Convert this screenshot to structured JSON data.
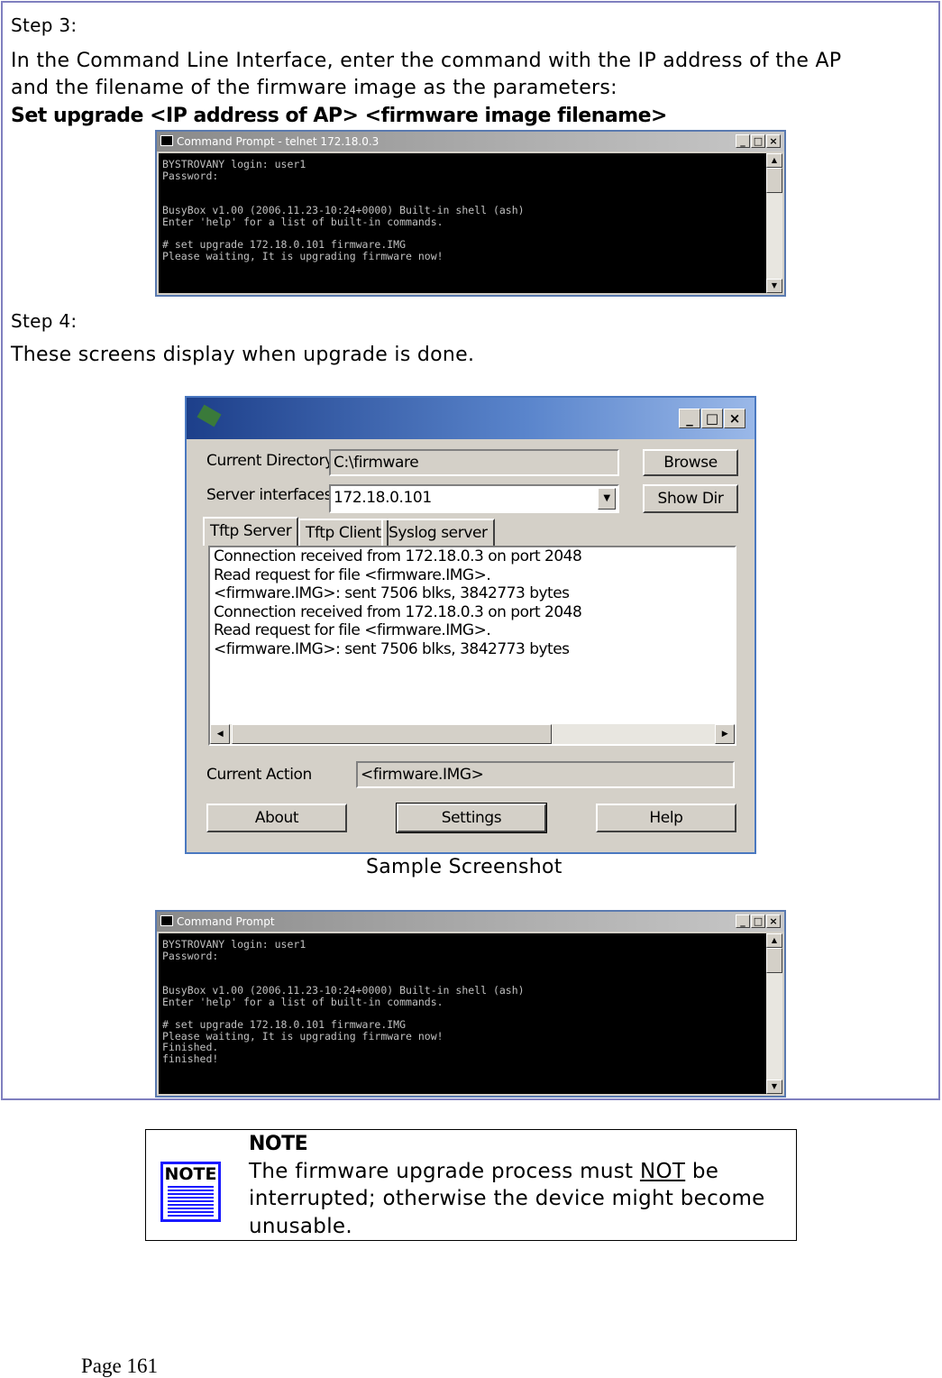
{
  "step3": {
    "heading": "Step 3:",
    "text1": "In the Command Line Interface, enter the command with the IP address of the AP",
    "text2": "and the filename of the firmware image as the parameters:",
    "command": "Set upgrade <IP address of AP> <firmware image filename>"
  },
  "terminal1": {
    "title": "Command Prompt - telnet 172.18.0.3",
    "lines": "BYSTROVANY login: user1\nPassword:\n\n\nBusyBox v1.00 (2006.11.23-10:24+0000) Built-in shell (ash)\nEnter 'help' for a list of built-in commands.\n\n# set upgrade 172.18.0.101 firmware.IMG\nPlease waiting, It is upgrading firmware now!"
  },
  "step4": {
    "heading": "Step 4:",
    "text": "These screens display when upgrade is done."
  },
  "tftp": {
    "current_directory_label": "Current Directory",
    "current_directory": "C:\\firmware",
    "server_interfaces_label": "Server interfaces",
    "server_interface": "172.18.0.101",
    "browse": "Browse",
    "show_dir": "Show Dir",
    "tabs": [
      "Tftp Server",
      "Tftp Client",
      "Syslog server"
    ],
    "log": [
      "Connection received from 172.18.0.3 on port 2048",
      "Read request for file <firmware.IMG>.",
      "<firmware.IMG>: sent 7506 blks, 3842773 bytes",
      "Connection received from 172.18.0.3 on port 2048",
      "Read request for file <firmware.IMG>.",
      "<firmware.IMG>: sent 7506 blks, 3842773 bytes"
    ],
    "current_action_label": "Current Action",
    "current_action": "<firmware.IMG>",
    "about": "About",
    "settings": "Settings",
    "help": "Help"
  },
  "caption": "Sample Screenshot",
  "terminal2": {
    "title": "Command Prompt",
    "lines": "BYSTROVANY login: user1\nPassword:\n\n\nBusyBox v1.00 (2006.11.23-10:24+0000) Built-in shell (ash)\nEnter 'help' for a list of built-in commands.\n\n# set upgrade 172.18.0.101 firmware.IMG\nPlease waiting, It is upgrading firmware now!\nFinished.\nfinished!"
  },
  "note": {
    "icon_label": "NOTE",
    "title": "NOTE",
    "line1_pre": "The firmware upgrade process must ",
    "line1_em": "NOT",
    "line1_post": " be",
    "line2": "interrupted; otherwise the device might become",
    "line3": "unusable."
  },
  "footer": {
    "page": "Page 161"
  }
}
